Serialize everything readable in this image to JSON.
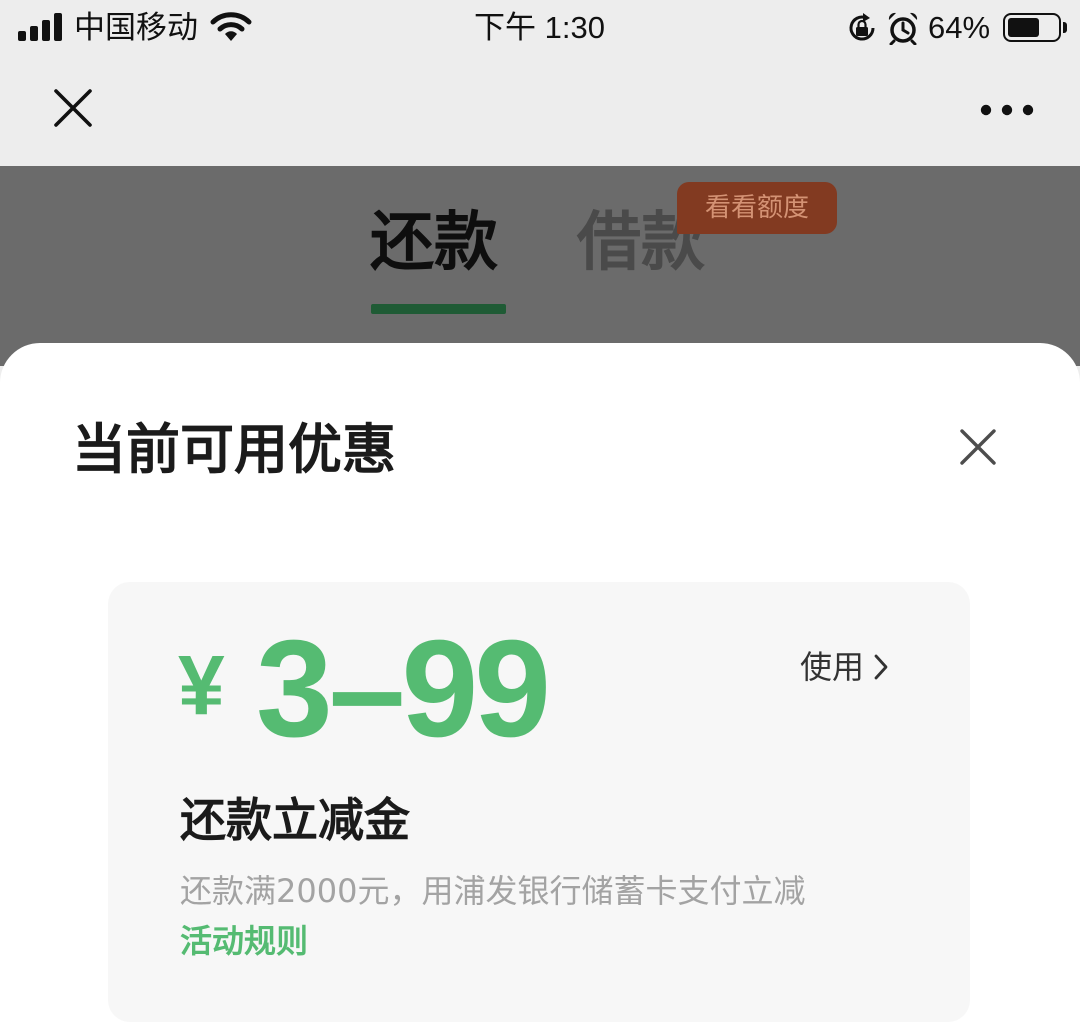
{
  "status_bar": {
    "carrier": "中国移动",
    "time": "下午 1:30",
    "battery_text": "64%",
    "battery_level": 0.64,
    "icons": [
      "signal-icon",
      "wifi-icon",
      "rotation-lock-icon",
      "alarm-icon",
      "battery-icon"
    ]
  },
  "nav": {
    "left_icon": "close-icon",
    "right_icon": "more-icon"
  },
  "tabs": [
    {
      "label": "还款",
      "active": true
    },
    {
      "label": "借款",
      "active": false
    }
  ],
  "badge": {
    "label": "看看额度"
  },
  "sheet": {
    "title": "当前可用优惠",
    "close_icon": "close-icon",
    "coupon": {
      "currency": "¥",
      "amount": "3–99",
      "use_label": "使用",
      "use_icon": "chevron-right-icon",
      "title": "还款立减金",
      "description": "还款满2000元，用浦发银行储蓄卡支付立减",
      "rules_label": "活动规则"
    }
  },
  "colors": {
    "accent_green": "#55bb72",
    "tab_underline": "#1f5b35",
    "badge_bg": "#823a21",
    "dim_overlay": "#6b6b6b",
    "sheet_bg": "#ffffff",
    "card_bg": "#f7f7f7"
  }
}
